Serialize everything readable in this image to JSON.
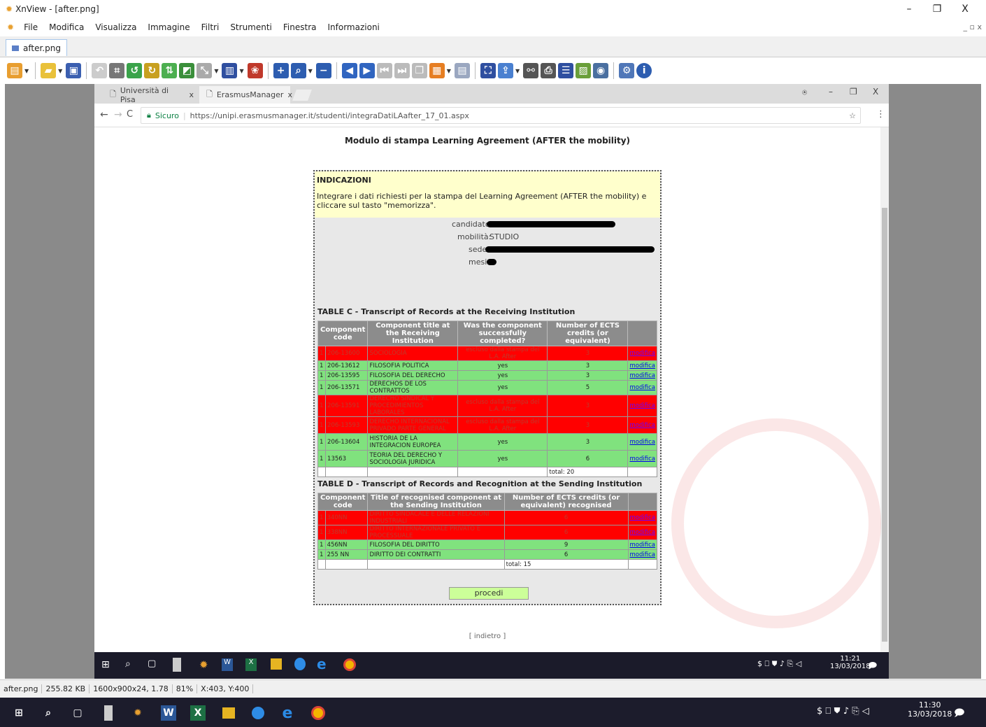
{
  "app": {
    "title": "XnView - [after.png]",
    "menu": [
      "File",
      "Modifica",
      "Visualizza",
      "Immagine",
      "Filtri",
      "Strumenti",
      "Finestra",
      "Informazioni"
    ],
    "tab": "after.png",
    "window_controls": {
      "minimize": "–",
      "restore": "❐",
      "close": "X"
    }
  },
  "browser": {
    "tabs": [
      "Università di Pisa",
      "ErasmusManager"
    ],
    "secure_label": "Sicuro",
    "url": "https://unipi.erasmusmanager.it/studenti/integraDatiLAafter_17_01.aspx"
  },
  "page": {
    "heading": "Modulo di stampa Learning Agreement (AFTER the mobility)",
    "indicazioni_title": "INDICAZIONI",
    "indicazioni_text": "Integrare i dati richiesti per la stampa del Learning Agreement (AFTER the mobility) e cliccare sul tasto \"memorizza\".",
    "fields": {
      "candidato_label": "candidato:",
      "mobilita_label": "mobilità:",
      "mobilita_value": "STUDIO",
      "sede_label": "sede:",
      "mesi_label": "mesi:"
    },
    "table_c": {
      "title": "TABLE C - Transcript of Records at the Receiving Institution",
      "headers": [
        "Component code",
        "Component title at the Receiving Institution",
        "Was the component successfully completed?",
        "Number of ECTS credits (or equivalent)"
      ],
      "rows": [
        {
          "status": "red",
          "n": "1",
          "code": "206-13600",
          "title": "SOCIOLOGIA",
          "completed": "escluso dalla stampa del L.A. After",
          "ects": "3",
          "action": "modifica"
        },
        {
          "status": "green",
          "n": "1",
          "code": "206-13612",
          "title": "FILOSOFIA POLITICA",
          "completed": "yes",
          "ects": "3",
          "action": "modifica"
        },
        {
          "status": "green",
          "n": "1",
          "code": "206-13595",
          "title": "FILOSOFIA DEL DERECHO",
          "completed": "yes",
          "ects": "3",
          "action": "modifica"
        },
        {
          "status": "green",
          "n": "1",
          "code": "206-13571",
          "title": "DERECHOS DE LOS CONTRATTOS",
          "completed": "yes",
          "ects": "5",
          "action": "modifica"
        },
        {
          "status": "red",
          "n": "1",
          "code": "206-13591",
          "title": "DERECHO SINDICAL Y PROCEDIMIENTOS LABORALES",
          "completed": "escluso dalla stampa del L.A. After",
          "ects": "3",
          "action": "modifica"
        },
        {
          "status": "red",
          "n": "1",
          "code": "206-13593",
          "title": "DERECHO INTERNACIONAL PRIVADO PARTE GENERAL",
          "completed": "escluso dalla stampa del L.A. After",
          "ects": "3",
          "action": "modifica"
        },
        {
          "status": "green",
          "n": "1",
          "code": "206-13604",
          "title": "HISTORIA DE LA INTEGRACION EUROPEA",
          "completed": "yes",
          "ects": "3",
          "action": "modifica"
        },
        {
          "status": "green",
          "n": "1",
          "code": "13563",
          "title": "TEORIA DEL DERECHO Y SOCIOLOGIA JURIDICA",
          "completed": "yes",
          "ects": "6",
          "action": "modifica"
        }
      ],
      "total": "total: 20"
    },
    "table_d": {
      "title": "TABLE D - Transcript of Records and Recognition at the Sending Institution",
      "headers": [
        "Component code",
        "Title of recognised component at the Sending Institution",
        "Number of ECTS credits (or equivalent) recognised"
      ],
      "rows": [
        {
          "status": "red",
          "n": "1",
          "code": "340NN",
          "title": "DIRITTO SINDACALE E DELLE RELAZIONI INDUSTRIALI",
          "ects": "6",
          "action": "modifica"
        },
        {
          "status": "red",
          "n": "1",
          "code": "338NN",
          "title": "DIRITTO INTERNAZIONALE PRIVATO E PROCESSUALE",
          "ects": "6",
          "action": "modifica"
        },
        {
          "status": "green",
          "n": "1",
          "code": "456NN",
          "title": "FILOSOFIA DEL DIRITTO",
          "ects": "9",
          "action": "modifica"
        },
        {
          "status": "green",
          "n": "1",
          "code": "255 NN",
          "title": "DIRITTO DEI CONTRATTI",
          "ects": "6",
          "action": "modifica"
        }
      ],
      "total": "total: 15"
    },
    "submit_label": "procedi",
    "back_link": "[ indietro ]"
  },
  "inner_taskbar": {
    "time": "11:21",
    "date": "13/03/2018"
  },
  "statusbar": [
    "after.png",
    "255.82 KB",
    "1600x900x24, 1.78",
    "81%",
    "X:403, Y:400"
  ],
  "taskbar": {
    "time": "11:30",
    "date": "13/03/2018"
  },
  "colors": {
    "red_row": "#ff0000",
    "green_row": "#80e27e",
    "indicazioni_bg": "#ffffcc",
    "procedi_bg": "#ccff99"
  }
}
